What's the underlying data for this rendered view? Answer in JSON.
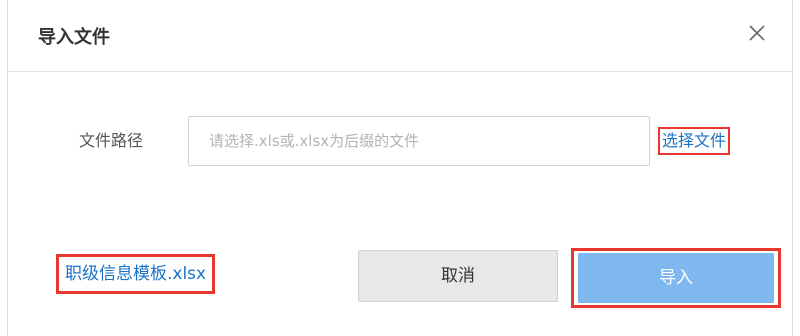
{
  "dialog": {
    "title": "导入文件",
    "close_icon": "close-icon"
  },
  "form": {
    "path_label": "文件路径",
    "path_value": "",
    "path_placeholder": "请选择.xls或.xlsx为后缀的文件",
    "choose_file_label": "选择文件"
  },
  "footer": {
    "template_link_label": "职级信息模板.xlsx",
    "cancel_label": "取消",
    "import_label": "导入"
  },
  "colors": {
    "link": "#1a73c8",
    "primary_button": "#7fb8ee",
    "highlight_border": "#e8372f",
    "cancel_button": "#e8e8e8"
  }
}
